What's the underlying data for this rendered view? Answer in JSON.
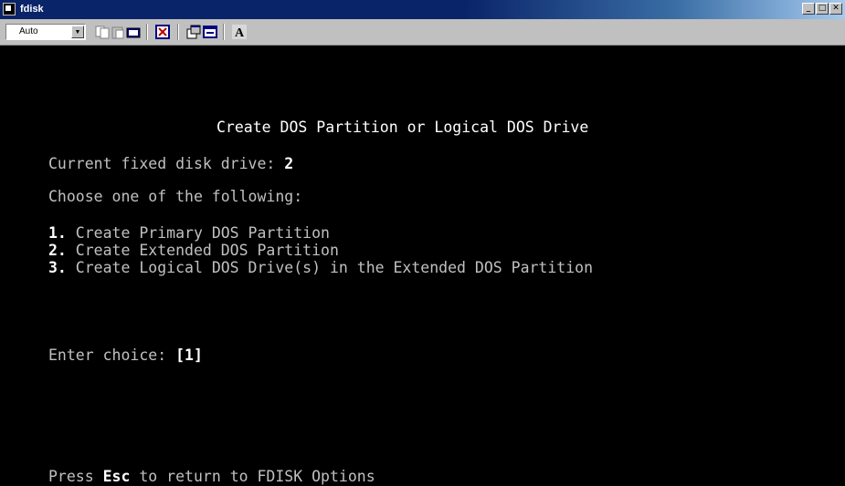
{
  "window": {
    "title": "fdisk",
    "buttons": {
      "minimize": "_",
      "maximize": "□",
      "close": "✕"
    }
  },
  "toolbar": {
    "font_select_value": "Auto",
    "font_button_label": "A",
    "icons": [
      "copy-icon",
      "paste-icon",
      "mark-icon",
      "fullscreen-icon",
      "properties-icon",
      "background-icon",
      "font-icon"
    ]
  },
  "console": {
    "heading": "Create DOS Partition or Logical DOS Drive",
    "current_drive_label": "Current fixed disk drive: ",
    "current_drive_value": "2",
    "choose_prompt": "Choose one of the following:",
    "options": [
      {
        "number": "1.",
        "label": " Create Primary DOS Partition"
      },
      {
        "number": "2.",
        "label": " Create Extended DOS Partition"
      },
      {
        "number": "3.",
        "label": " Create Logical DOS Drive(s) in the Extended DOS Partition"
      }
    ],
    "enter_choice_label": "Enter choice: ",
    "enter_choice_value": "[1]",
    "footer_prefix": "Press ",
    "footer_key": "Esc",
    "footer_suffix": " to return to FDISK Options"
  },
  "colors": {
    "title_bar": "#0a246a",
    "console_bg": "#000000",
    "console_text": "#c0c0c0",
    "console_highlight": "#ffffff",
    "chrome": "#c0c0c0"
  }
}
